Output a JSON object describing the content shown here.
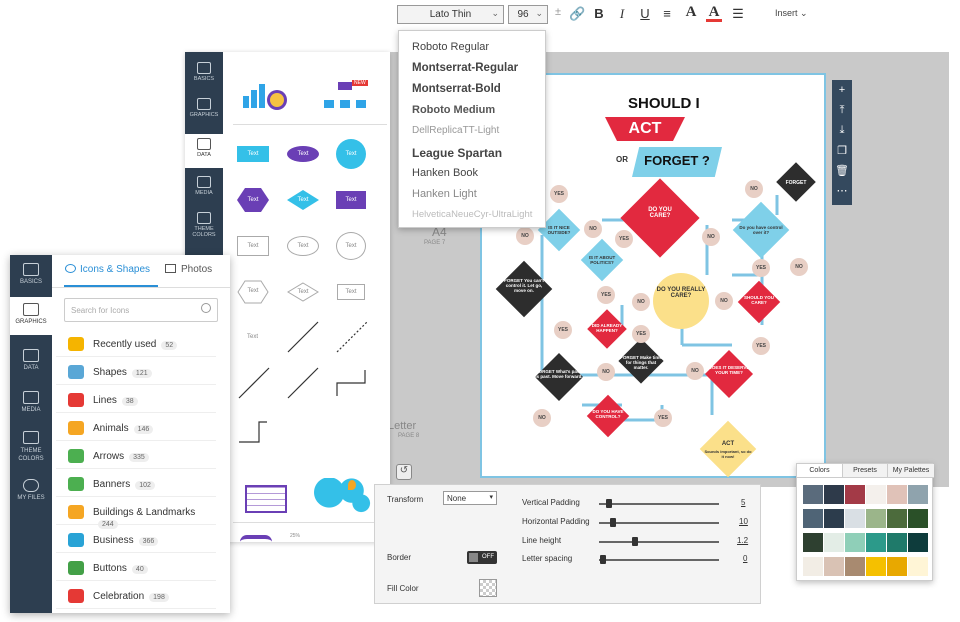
{
  "toolbar": {
    "font_family": "Lato Thin",
    "font_size": "96",
    "insert_label": "Insert",
    "icons": [
      "plus-minus-icon",
      "link-icon",
      "bold-icon",
      "italic-icon",
      "underline-icon",
      "align-icon",
      "text-color-icon",
      "highlight-icon",
      "spacing-icon"
    ]
  },
  "font_menu": {
    "options": [
      "Roboto Regular",
      "Montserrat-Regular",
      "Montserrat-Bold",
      "Roboto Medium",
      "DellReplicaTT-Light",
      "League Spartan",
      "Hanken Book",
      "Hanken Light",
      "HelveticaNeueCyr-UltraLight"
    ]
  },
  "back_nav": [
    "BASICS",
    "GRAPHICS",
    "DATA",
    "MEDIA",
    "THEME COLORS"
  ],
  "new_badge": "NEW",
  "shape_labels": {
    "text": "Text"
  },
  "front_nav": [
    "BASICS",
    "GRAPHICS",
    "DATA",
    "MEDIA",
    "THEME COLORS",
    "MY FILES"
  ],
  "front_tabs": {
    "icons": "Icons & Shapes",
    "photos": "Photos"
  },
  "search": {
    "placeholder": "Search for Icons"
  },
  "categories": [
    {
      "label": "Recently used",
      "count": "52",
      "color": "#f5b400"
    },
    {
      "label": "Shapes",
      "count": "121",
      "color": "#5aa7d6"
    },
    {
      "label": "Lines",
      "count": "38",
      "color": "#e53935"
    },
    {
      "label": "Animals",
      "count": "146",
      "color": "#f5a623"
    },
    {
      "label": "Arrows",
      "count": "335",
      "color": "#4caf50"
    },
    {
      "label": "Banners",
      "count": "102",
      "color": "#4caf50"
    },
    {
      "label": "Buildings & Landmarks",
      "count": "244",
      "color": "#f5a623"
    },
    {
      "label": "Business",
      "count": "366",
      "color": "#29a3d6"
    },
    {
      "label": "Buttons",
      "count": "40",
      "color": "#43a047"
    },
    {
      "label": "Celebration",
      "count": "198",
      "color": "#e53935"
    }
  ],
  "canvas": {
    "page_a4": "A4",
    "page_a4_num": "PAGE 7",
    "page_letter": "Letter",
    "page_letter_num": "PAGE 8"
  },
  "flowchart": {
    "title1": "SHOULD I",
    "act": "ACT",
    "or": "OR",
    "forget": "FORGET ?",
    "nodes": {
      "do_you_care": "DO YOU CARE?",
      "is_it_nice": "IS IT NICE OUTSIDE?",
      "is_it_political": "IS IT ABOUT POLITICS?",
      "do_you_have_control": "Do you have control over it?",
      "forget_top": "FORGET",
      "forget_control": "FORGET You can't control it. Let go, move on.",
      "really_care": "DO YOU REALLY CARE?",
      "should_care": "SHOULD YOU CARE?",
      "already_happen": "DID ALREADY HAPPEN?",
      "forget_time": "FORGET Make time for things that matter.",
      "forget_past": "FORGET What's past, is past. Move forward.",
      "deserve_time": "DOES IT DESERVE YOUR TIME?",
      "have_control": "DO YOU HAVE CONTROL?",
      "act_bottom": "ACT",
      "act_bottom_sub": "Sounds important, so do it now!",
      "yes": "YES",
      "no": "NO"
    }
  },
  "properties": {
    "transform_label": "Transform",
    "transform_value": "None",
    "border_label": "Border",
    "border_toggle": "OFF",
    "fill_label": "Fill Color",
    "vpad_label": "Vertical Padding",
    "vpad_value": "5",
    "vpad_level": 0.08,
    "hpad_label": "Horizontal Padding",
    "hpad_value": "10",
    "hpad_level": 0.12,
    "lh_label": "Line height",
    "lh_value": "1.2",
    "lh_level": 0.3,
    "ls_label": "Letter spacing",
    "ls_value": "0",
    "ls_level": 0.03
  },
  "color_panel": {
    "tabs": [
      "Colors",
      "Presets",
      "My Palettes"
    ],
    "rows": [
      [
        "#5a6b7c",
        "#2e3a4a",
        "#a33a47",
        "#f4f0ec",
        "#e0c2b8",
        "#8fa3ad"
      ],
      [
        "#4f6476",
        "#2c3c4c",
        "#d9dfe4",
        "#9bb58a",
        "#4c6b3c",
        "#2a5028"
      ],
      [
        "#2e4030",
        "#e3ede6",
        "#8fcfb8",
        "#2c9a8a",
        "#1f7a6a",
        "#0e3c3c"
      ],
      [
        "#f2ede5",
        "#d9c2b4",
        "#a88a70",
        "#f5c000",
        "#e8a800",
        "#fff5d6"
      ]
    ]
  }
}
